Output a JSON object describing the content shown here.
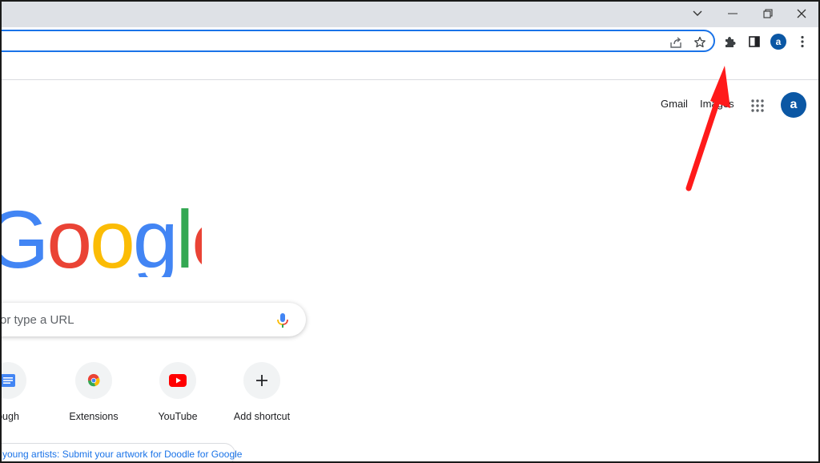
{
  "titlebar": {
    "icons": [
      "chevron-down-icon",
      "minimize-icon",
      "restore-icon",
      "close-icon"
    ]
  },
  "toolbar": {
    "omnibox_icons": [
      "share-icon",
      "bookmark-star-icon"
    ],
    "icons": [
      "extensions-puzzle-icon",
      "side-panel-icon",
      "profile-avatar",
      "kebab-menu-icon"
    ],
    "profile_initial": "a"
  },
  "ntp": {
    "links": {
      "gmail": "Gmail",
      "images": "Images"
    },
    "profile_initial": "a",
    "logo_text": "Google",
    "search_placeholder": "Search Google or type a URL",
    "search_placeholder_visible": "or type a URL",
    "shortcuts": [
      {
        "label": "ough",
        "icon": "docs-icon"
      },
      {
        "label": "Extensions",
        "icon": "chrome-icon"
      },
      {
        "label": "YouTube",
        "icon": "youtube-icon"
      },
      {
        "label": "Add shortcut",
        "icon": "plus-icon"
      }
    ],
    "promo": "young artists: Submit your artwork for Doodle for Google"
  },
  "colors": {
    "accent": "#1a73e8",
    "avatar": "#0b57a4",
    "titlebar": "#dee1e6",
    "annotation_arrow": "#ff1a1a",
    "google_blue": "#4285f4",
    "google_red": "#ea4335",
    "google_yellow": "#fbbc05",
    "google_green": "#34a853"
  }
}
